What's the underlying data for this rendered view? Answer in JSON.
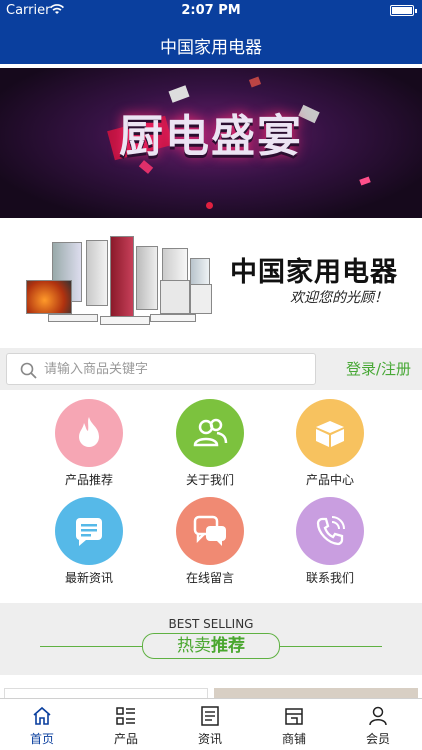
{
  "status_bar": {
    "carrier": "Carrier",
    "time": "2:07 PM"
  },
  "nav": {
    "title": "中国家用电器"
  },
  "banner1": {
    "headline": "厨电盛宴"
  },
  "banner2": {
    "brand": "中国家用电器",
    "slogan": "欢迎您的光顾！"
  },
  "search": {
    "placeholder": "请输入商品关键字",
    "value": "",
    "login_label": "登录/注册"
  },
  "categories": [
    {
      "label": "产品推荐",
      "icon": "flame-icon",
      "color": "#f6a6b4"
    },
    {
      "label": "关于我们",
      "icon": "users-icon",
      "color": "#7cc23e"
    },
    {
      "label": "产品中心",
      "icon": "box-icon",
      "color": "#f7c25f"
    },
    {
      "label": "最新资讯",
      "icon": "message-icon",
      "color": "#56b9e8"
    },
    {
      "label": "在线留言",
      "icon": "chat-icon",
      "color": "#f08a73"
    },
    {
      "label": "联系我们",
      "icon": "phone-icon",
      "color": "#c99ee0"
    }
  ],
  "section": {
    "title_en": "BEST SELLING",
    "title_cn_a": "热卖",
    "title_cn_b": "推荐"
  },
  "tabs": [
    {
      "label": "首页",
      "icon": "home-icon",
      "active": true
    },
    {
      "label": "产品",
      "icon": "list-icon",
      "active": false
    },
    {
      "label": "资讯",
      "icon": "news-icon",
      "active": false
    },
    {
      "label": "商铺",
      "icon": "shop-icon",
      "active": false
    },
    {
      "label": "会员",
      "icon": "user-icon",
      "active": false
    }
  ],
  "colors": {
    "brand_blue": "#0a3f9e",
    "accent_green": "#4aa72f",
    "section_bg": "#eeeeee"
  }
}
